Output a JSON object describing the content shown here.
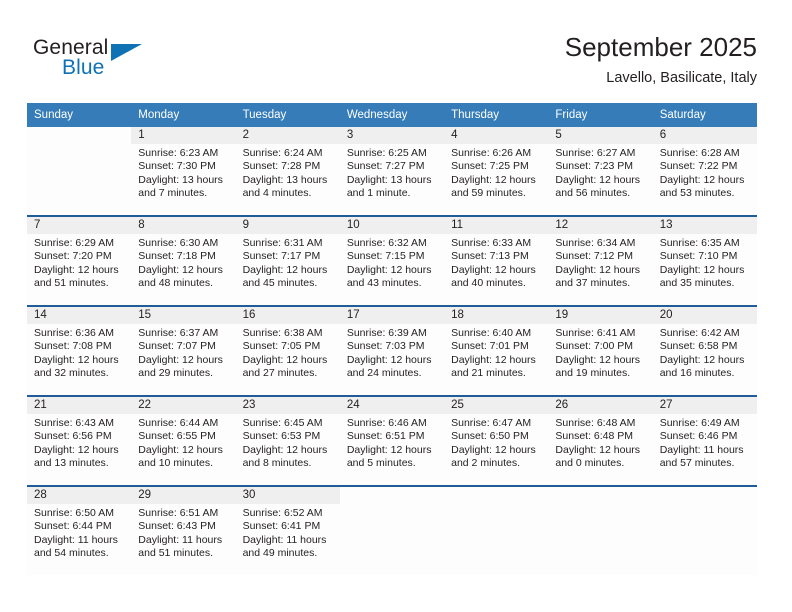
{
  "brand": {
    "word_one": "General",
    "word_two": "Blue",
    "triangle_icon": "triangle-logo-icon"
  },
  "header": {
    "title": "September 2025",
    "subtitle": "Lavello, Basilicate, Italy"
  },
  "colors": {
    "header_blue": "#357cb8",
    "row_divider_blue": "#1f5c99",
    "date_band_gray": "#efefef",
    "brand_blue": "#0e72b5",
    "text": "#231f20"
  },
  "weekdays": [
    "Sunday",
    "Monday",
    "Tuesday",
    "Wednesday",
    "Thursday",
    "Friday",
    "Saturday"
  ],
  "weeks": [
    [
      {
        "day": "",
        "lines": []
      },
      {
        "day": "1",
        "lines": [
          "Sunrise: 6:23 AM",
          "Sunset: 7:30 PM",
          "Daylight: 13 hours",
          "and 7 minutes."
        ]
      },
      {
        "day": "2",
        "lines": [
          "Sunrise: 6:24 AM",
          "Sunset: 7:28 PM",
          "Daylight: 13 hours",
          "and 4 minutes."
        ]
      },
      {
        "day": "3",
        "lines": [
          "Sunrise: 6:25 AM",
          "Sunset: 7:27 PM",
          "Daylight: 13 hours",
          "and 1 minute."
        ]
      },
      {
        "day": "4",
        "lines": [
          "Sunrise: 6:26 AM",
          "Sunset: 7:25 PM",
          "Daylight: 12 hours",
          "and 59 minutes."
        ]
      },
      {
        "day": "5",
        "lines": [
          "Sunrise: 6:27 AM",
          "Sunset: 7:23 PM",
          "Daylight: 12 hours",
          "and 56 minutes."
        ]
      },
      {
        "day": "6",
        "lines": [
          "Sunrise: 6:28 AM",
          "Sunset: 7:22 PM",
          "Daylight: 12 hours",
          "and 53 minutes."
        ]
      }
    ],
    [
      {
        "day": "7",
        "lines": [
          "Sunrise: 6:29 AM",
          "Sunset: 7:20 PM",
          "Daylight: 12 hours",
          "and 51 minutes."
        ]
      },
      {
        "day": "8",
        "lines": [
          "Sunrise: 6:30 AM",
          "Sunset: 7:18 PM",
          "Daylight: 12 hours",
          "and 48 minutes."
        ]
      },
      {
        "day": "9",
        "lines": [
          "Sunrise: 6:31 AM",
          "Sunset: 7:17 PM",
          "Daylight: 12 hours",
          "and 45 minutes."
        ]
      },
      {
        "day": "10",
        "lines": [
          "Sunrise: 6:32 AM",
          "Sunset: 7:15 PM",
          "Daylight: 12 hours",
          "and 43 minutes."
        ]
      },
      {
        "day": "11",
        "lines": [
          "Sunrise: 6:33 AM",
          "Sunset: 7:13 PM",
          "Daylight: 12 hours",
          "and 40 minutes."
        ]
      },
      {
        "day": "12",
        "lines": [
          "Sunrise: 6:34 AM",
          "Sunset: 7:12 PM",
          "Daylight: 12 hours",
          "and 37 minutes."
        ]
      },
      {
        "day": "13",
        "lines": [
          "Sunrise: 6:35 AM",
          "Sunset: 7:10 PM",
          "Daylight: 12 hours",
          "and 35 minutes."
        ]
      }
    ],
    [
      {
        "day": "14",
        "lines": [
          "Sunrise: 6:36 AM",
          "Sunset: 7:08 PM",
          "Daylight: 12 hours",
          "and 32 minutes."
        ]
      },
      {
        "day": "15",
        "lines": [
          "Sunrise: 6:37 AM",
          "Sunset: 7:07 PM",
          "Daylight: 12 hours",
          "and 29 minutes."
        ]
      },
      {
        "day": "16",
        "lines": [
          "Sunrise: 6:38 AM",
          "Sunset: 7:05 PM",
          "Daylight: 12 hours",
          "and 27 minutes."
        ]
      },
      {
        "day": "17",
        "lines": [
          "Sunrise: 6:39 AM",
          "Sunset: 7:03 PM",
          "Daylight: 12 hours",
          "and 24 minutes."
        ]
      },
      {
        "day": "18",
        "lines": [
          "Sunrise: 6:40 AM",
          "Sunset: 7:01 PM",
          "Daylight: 12 hours",
          "and 21 minutes."
        ]
      },
      {
        "day": "19",
        "lines": [
          "Sunrise: 6:41 AM",
          "Sunset: 7:00 PM",
          "Daylight: 12 hours",
          "and 19 minutes."
        ]
      },
      {
        "day": "20",
        "lines": [
          "Sunrise: 6:42 AM",
          "Sunset: 6:58 PM",
          "Daylight: 12 hours",
          "and 16 minutes."
        ]
      }
    ],
    [
      {
        "day": "21",
        "lines": [
          "Sunrise: 6:43 AM",
          "Sunset: 6:56 PM",
          "Daylight: 12 hours",
          "and 13 minutes."
        ]
      },
      {
        "day": "22",
        "lines": [
          "Sunrise: 6:44 AM",
          "Sunset: 6:55 PM",
          "Daylight: 12 hours",
          "and 10 minutes."
        ]
      },
      {
        "day": "23",
        "lines": [
          "Sunrise: 6:45 AM",
          "Sunset: 6:53 PM",
          "Daylight: 12 hours",
          "and 8 minutes."
        ]
      },
      {
        "day": "24",
        "lines": [
          "Sunrise: 6:46 AM",
          "Sunset: 6:51 PM",
          "Daylight: 12 hours",
          "and 5 minutes."
        ]
      },
      {
        "day": "25",
        "lines": [
          "Sunrise: 6:47 AM",
          "Sunset: 6:50 PM",
          "Daylight: 12 hours",
          "and 2 minutes."
        ]
      },
      {
        "day": "26",
        "lines": [
          "Sunrise: 6:48 AM",
          "Sunset: 6:48 PM",
          "Daylight: 12 hours",
          "and 0 minutes."
        ]
      },
      {
        "day": "27",
        "lines": [
          "Sunrise: 6:49 AM",
          "Sunset: 6:46 PM",
          "Daylight: 11 hours",
          "and 57 minutes."
        ]
      }
    ],
    [
      {
        "day": "28",
        "lines": [
          "Sunrise: 6:50 AM",
          "Sunset: 6:44 PM",
          "Daylight: 11 hours",
          "and 54 minutes."
        ]
      },
      {
        "day": "29",
        "lines": [
          "Sunrise: 6:51 AM",
          "Sunset: 6:43 PM",
          "Daylight: 11 hours",
          "and 51 minutes."
        ]
      },
      {
        "day": "30",
        "lines": [
          "Sunrise: 6:52 AM",
          "Sunset: 6:41 PM",
          "Daylight: 11 hours",
          "and 49 minutes."
        ]
      },
      {
        "day": "",
        "lines": []
      },
      {
        "day": "",
        "lines": []
      },
      {
        "day": "",
        "lines": []
      },
      {
        "day": "",
        "lines": []
      }
    ]
  ]
}
